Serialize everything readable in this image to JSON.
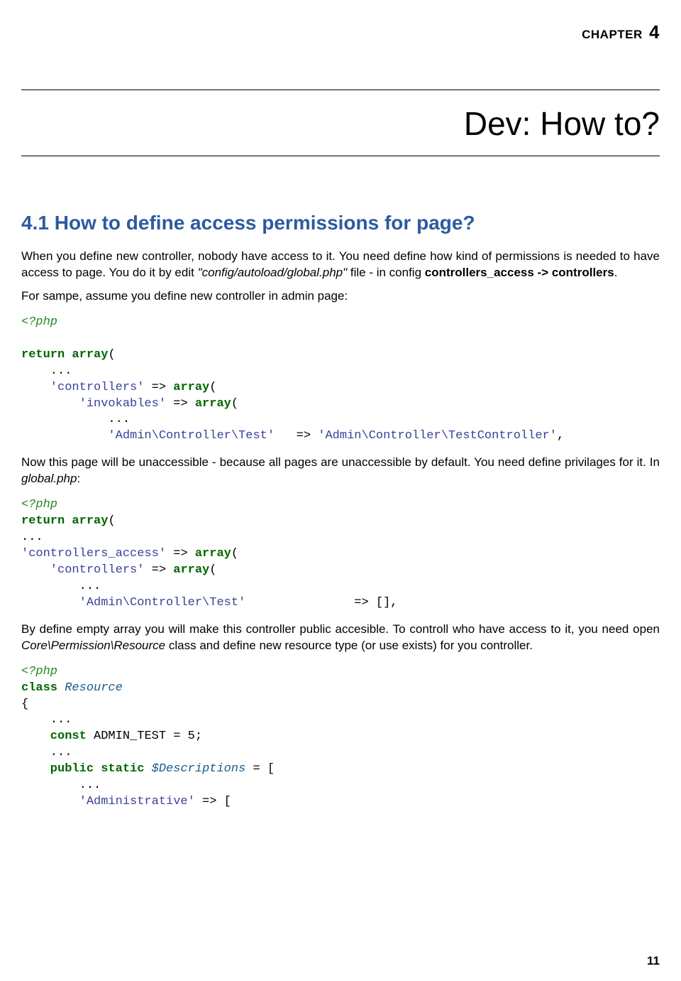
{
  "chapter_label": "CHAPTER",
  "chapter_number": "4",
  "chapter_title": "Dev: How to?",
  "section_number": "4.1",
  "section_title": "How to define access permissions for page?",
  "p1_a": "When you define new controller, nobody have access to it. You need define how kind of permissions is needed to have access to page. You do it by edit ",
  "p1_b": "\"config/autoload/global.php\"",
  "p1_c": " file - in config ",
  "p1_d": "controllers_access -> controllers",
  "p1_e": ".",
  "p2": "For sampe, assume you define new controller in admin page:",
  "code1": {
    "l1": "<?php",
    "l2": "",
    "l3_a": "return",
    "l3_b": " array",
    "l3_c": "(",
    "l4": "    ...",
    "l5_a": "    'controllers'",
    "l5_b": " => ",
    "l5_c": "array",
    "l5_d": "(",
    "l6_a": "        'invokables'",
    "l6_b": " => ",
    "l6_c": "array",
    "l6_d": "(",
    "l7": "            ...",
    "l8_a": "            'Admin\\Controller\\Test'",
    "l8_b": "   => ",
    "l8_c": "'Admin\\Controller\\TestController'",
    "l8_d": ","
  },
  "p3_a": "Now this page will be unaccessible - because all pages are unaccessible by default. You need define privilages for it. In ",
  "p3_b": "global.php",
  "p3_c": ":",
  "code2": {
    "l1": "<?php",
    "l2_a": "return",
    "l2_b": " array",
    "l2_c": "(",
    "l3": "...",
    "l4_a": "'controllers_access'",
    "l4_b": " => ",
    "l4_c": "array",
    "l4_d": "(",
    "l5_a": "    'controllers'",
    "l5_b": " => ",
    "l5_c": "array",
    "l5_d": "(",
    "l6": "        ...",
    "l7_a": "        'Admin\\Controller\\Test'",
    "l7_b": "               => [],"
  },
  "p4_a": "By define empty array you will make this controller public accesible. To controll who have access to it, you need open ",
  "p4_b": "Core\\Permission\\Resource",
  "p4_c": " class and define new resource type (or use exists) for you controller.",
  "code3": {
    "l1": "<?php",
    "l2_a": "class",
    "l2_b": " Resource",
    "l3": "{",
    "l4": "    ...",
    "l5_a": "    const",
    "l5_b": " ADMIN_TEST",
    "l5_c": " = ",
    "l5_d": "5",
    "l5_e": ";",
    "l6": "    ...",
    "l7_a": "    public",
    "l7_b": " static",
    "l7_c": " $Descriptions",
    "l7_d": " = [",
    "l8": "        ...",
    "l9_a": "        'Administrative'",
    "l9_b": " => ["
  },
  "page_number": "11"
}
